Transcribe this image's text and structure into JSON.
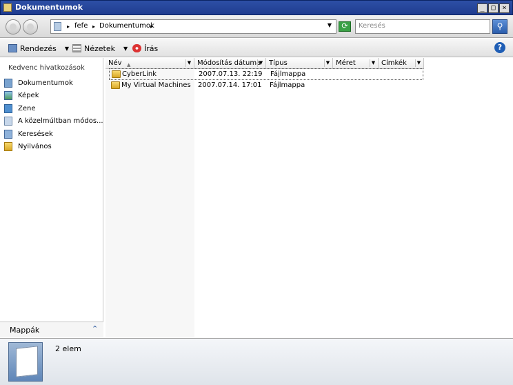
{
  "window": {
    "title": "Dokumentumok"
  },
  "address": {
    "crumbs": [
      "fefe",
      "Dokumentumok"
    ],
    "search_placeholder": "Keresés"
  },
  "toolbar": {
    "organize_label": "Rendezés",
    "views_label": "Nézetek",
    "burn_label": "Írás"
  },
  "nav_pane": {
    "heading": "Kedvenc hivatkozások",
    "items": [
      {
        "label": "Dokumentumok",
        "icon": "documents-icon"
      },
      {
        "label": "Képek",
        "icon": "pictures-icon"
      },
      {
        "label": "Zene",
        "icon": "music-icon"
      },
      {
        "label": "A közelmúltban módos...",
        "icon": "recent-icon"
      },
      {
        "label": "Keresések",
        "icon": "searches-icon"
      },
      {
        "label": "Nyilvános",
        "icon": "public-folder-icon"
      }
    ],
    "folders_label": "Mappák"
  },
  "file_list": {
    "columns": [
      "Név",
      "Módosítás dátuma",
      "Típus",
      "Méret",
      "Címkék"
    ],
    "rows": [
      {
        "name": "CyberLink",
        "modified": "2007.07.13. 22:19",
        "type": "Fájlmappa",
        "size": "",
        "tags": ""
      },
      {
        "name": "My Virtual Machines",
        "modified": "2007.07.14. 17:01",
        "type": "Fájlmappa",
        "size": "",
        "tags": ""
      }
    ]
  },
  "details_pane": {
    "count": "2 elem"
  },
  "colors": {
    "titlebar": "#1f3c8f",
    "folder": "#e8c14a",
    "selection_border": "#555555"
  }
}
